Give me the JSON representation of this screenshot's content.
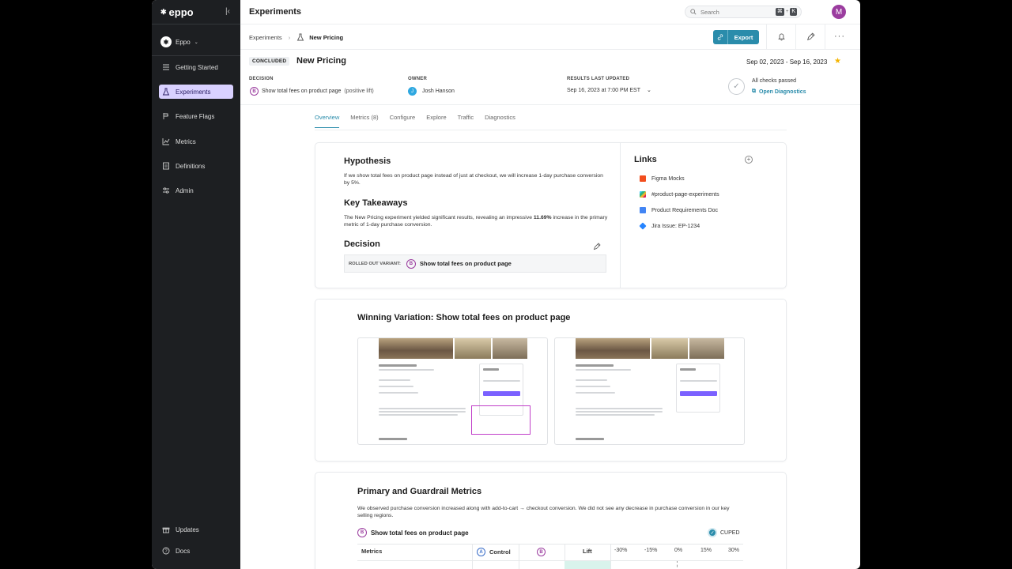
{
  "sidebar": {
    "logo": "eppo",
    "workspace": "Eppo",
    "items": [
      {
        "label": "Getting Started",
        "icon": "list-icon"
      },
      {
        "label": "Experiments",
        "icon": "flask-icon",
        "active": true
      },
      {
        "label": "Feature Flags",
        "icon": "flag-icon"
      },
      {
        "label": "Metrics",
        "icon": "chart-icon"
      },
      {
        "label": "Definitions",
        "icon": "document-icon"
      },
      {
        "label": "Admin",
        "icon": "sliders-icon"
      }
    ],
    "bottom": [
      {
        "label": "Updates",
        "icon": "gift-icon"
      },
      {
        "label": "Docs",
        "icon": "help-icon"
      }
    ]
  },
  "header": {
    "title": "Experiments",
    "search_placeholder": "Search",
    "shortcut": [
      "⌘",
      "+",
      "K"
    ],
    "avatar": "M"
  },
  "breadcrumb": {
    "parent": "Experiments",
    "current": "New Pricing"
  },
  "toolbar": {
    "export_label": "Export"
  },
  "experiment": {
    "status": "CONCLUDED",
    "name": "New Pricing",
    "date_range": "Sep 02, 2023 - Sep 16, 2023",
    "decision_label": "DECISION",
    "decision_variant": "B",
    "decision_value": "Show total fees on product page",
    "decision_note": "(positive lift)",
    "owner_label": "OWNER",
    "owner_initial": "J",
    "owner_name": "Josh Hanson",
    "updated_label": "RESULTS LAST UPDATED",
    "updated_value": "Sep 16, 2023 at 7:00 PM EST",
    "checks_label": "All checks passed",
    "diagnostics_link": "Open Diagnostics"
  },
  "tabs": [
    "Overview",
    "Metrics (8)",
    "Configure",
    "Explore",
    "Traffic",
    "Diagnostics"
  ],
  "overview": {
    "hypothesis_title": "Hypothesis",
    "hypothesis_text": "If we show total fees on product page instead of just at checkout, we will increase 1-day purchase conversion by 5%.",
    "takeaways_title": "Key Takeaways",
    "takeaways_text_1": "The New Pricing experiment yielded significant results, revealing an impressive ",
    "takeaways_highlight": "11.69%",
    "takeaways_text_2": " increase in the primary metric of 1-day purchase conversion.",
    "decision_title": "Decision",
    "rollout_label": "ROLLED OUT VARIANT:",
    "rollout_variant": "B",
    "rollout_value": "Show total fees on product page",
    "links_title": "Links",
    "links": [
      {
        "label": "Figma Mocks",
        "icon": "figma-icon",
        "color": "#f24e1e"
      },
      {
        "label": "#product-page-experiments",
        "icon": "slack-icon",
        "color": "#36c5f0"
      },
      {
        "label": "Product Requirements Doc",
        "icon": "google-docs-icon",
        "color": "#4285f4"
      },
      {
        "label": "Jira Issue: EP-1234",
        "icon": "jira-icon",
        "color": "#2684ff"
      }
    ]
  },
  "winning": {
    "title": "Winning Variation: Show total fees on product page"
  },
  "metrics": {
    "title": "Primary and Guardrail Metrics",
    "description": "We observed purchase conversion increased along with add-to-cart → checkout conversion. We did not see any decrease in purchase conversion in our key selling regions.",
    "variant_badge": "B",
    "variant_label": "Show total fees on product page",
    "cuped_label": "CUPED",
    "columns": {
      "metrics": "Metrics",
      "control_badge": "A",
      "control": "Control",
      "treatment_badge": "B",
      "lift": "Lift"
    },
    "axis_ticks": [
      "-30%",
      "-15%",
      "0%",
      "15%",
      "30%"
    ]
  },
  "colors": {
    "accent": "#2a8cab",
    "sidebar_bg": "#1d1f22",
    "active_nav": "#d9d1ff",
    "variant_b": "#9b3d9f"
  }
}
